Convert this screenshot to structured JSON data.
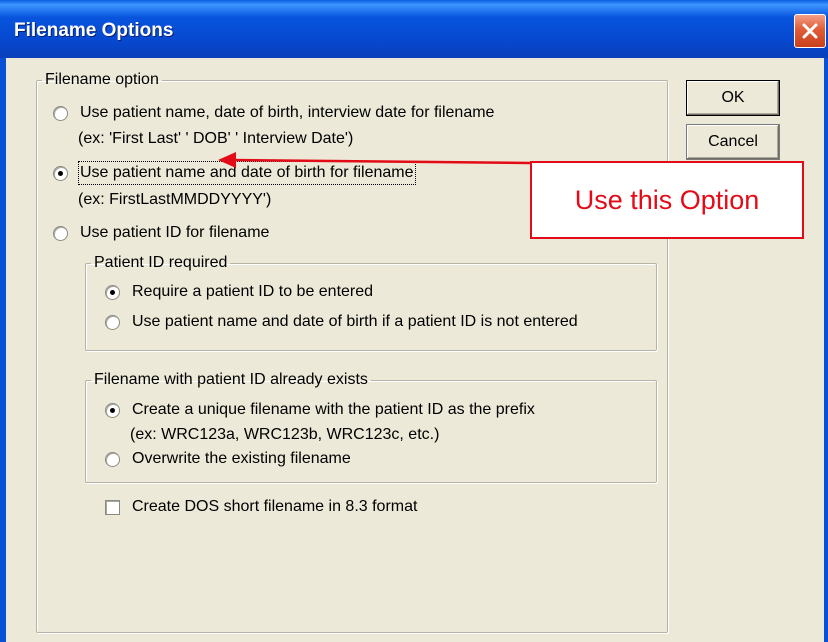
{
  "window": {
    "title": "Filename Options"
  },
  "colors": {
    "titlebar": "#0a50d6",
    "dialog_bg": "#ece9d8",
    "annotation_red": "#e30b17"
  },
  "icons": {
    "close": "close-icon"
  },
  "buttons": {
    "ok": "OK",
    "cancel": "Cancel"
  },
  "filename_option": {
    "legend": "Filename option",
    "options": [
      {
        "label": "Use patient name, date of birth, interview date for filename",
        "example": "(ex: 'First Last' ' DOB' ' Interview Date')",
        "checked": false
      },
      {
        "label": "Use patient name and date of birth for filename",
        "example": "(ex: FirstLastMMDDYYYY')",
        "checked": true
      },
      {
        "label": "Use patient ID for filename",
        "checked": false
      }
    ]
  },
  "patient_id_required": {
    "legend": "Patient ID required",
    "options": [
      {
        "label": "Require a patient ID to be entered",
        "checked": true
      },
      {
        "label": "Use patient name and date of birth if a patient ID is not entered",
        "checked": false
      }
    ]
  },
  "filename_exists": {
    "legend": "Filename with patient ID already exists",
    "options": [
      {
        "label": "Create a unique filename with the patient ID as the prefix",
        "example": "(ex: WRC123a, WRC123b, WRC123c, etc.)",
        "checked": true
      },
      {
        "label": "Overwrite the existing filename",
        "checked": false
      }
    ]
  },
  "dos_checkbox": {
    "label": "Create DOS short filename in 8.3 format",
    "checked": false
  },
  "annotation": {
    "text": "Use this Option"
  }
}
